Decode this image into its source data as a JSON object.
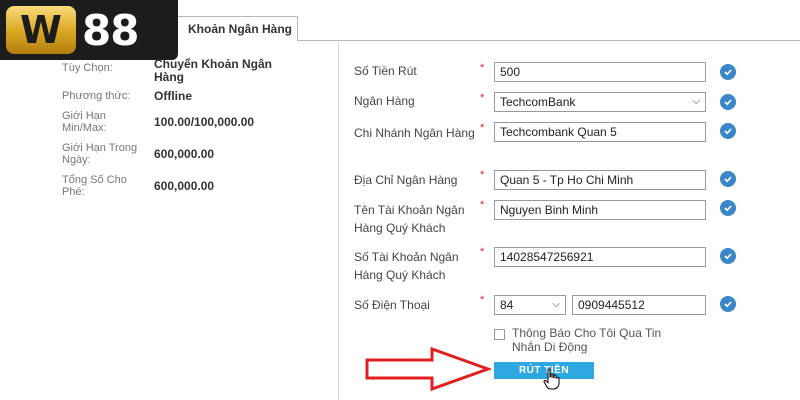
{
  "logo": {
    "w": "W",
    "num": "88"
  },
  "tab": {
    "label": "Khoản Ngân Hàng"
  },
  "info": [
    {
      "label": "Tùy Chọn:",
      "value": "Chuyển Khoản Ngân Hàng"
    },
    {
      "label": "Phương thức:",
      "value": "Offline"
    },
    {
      "label": "Giới Hạn Min/Max:",
      "value": "100.00/100,000.00"
    },
    {
      "label": "Giới Hạn Trong Ngày:",
      "value": "600,000.00"
    },
    {
      "label": "Tổng Số Cho Phé:",
      "value": "600,000.00"
    }
  ],
  "form": {
    "required_mark": "*",
    "amount": {
      "label": "Số Tiền Rút",
      "value": "500"
    },
    "bank": {
      "label": "Ngân Hàng",
      "value": "TechcomBank"
    },
    "branch": {
      "label": "Chi Nhánh Ngân Hàng",
      "value": "Techcombank Quan 5"
    },
    "address": {
      "label": "Địa Chỉ Ngân Hàng",
      "value": "Quan 5 - Tp Ho Chi Minh"
    },
    "account_name": {
      "label": "Tên Tài Khoản Ngân Hàng Quý Khách",
      "value": "Nguyen Binh Minh"
    },
    "account_number": {
      "label": "Số Tài Khoản Ngân Hàng Quý Khách",
      "value": "14028547256921"
    },
    "phone": {
      "label": "Số Điện Thoại",
      "code": "84",
      "value": "0909445512"
    },
    "notify_label": "Thông Báo Cho Tôi Qua Tin Nhắn Di Động",
    "submit_label": "RÚT TIỀN"
  },
  "colors": {
    "accent": "#2ea8e0",
    "check": "#3a86c8",
    "arrow": "#e02020",
    "logo_bg": "#1c1c1c",
    "logo_gold": "#d9a520"
  }
}
